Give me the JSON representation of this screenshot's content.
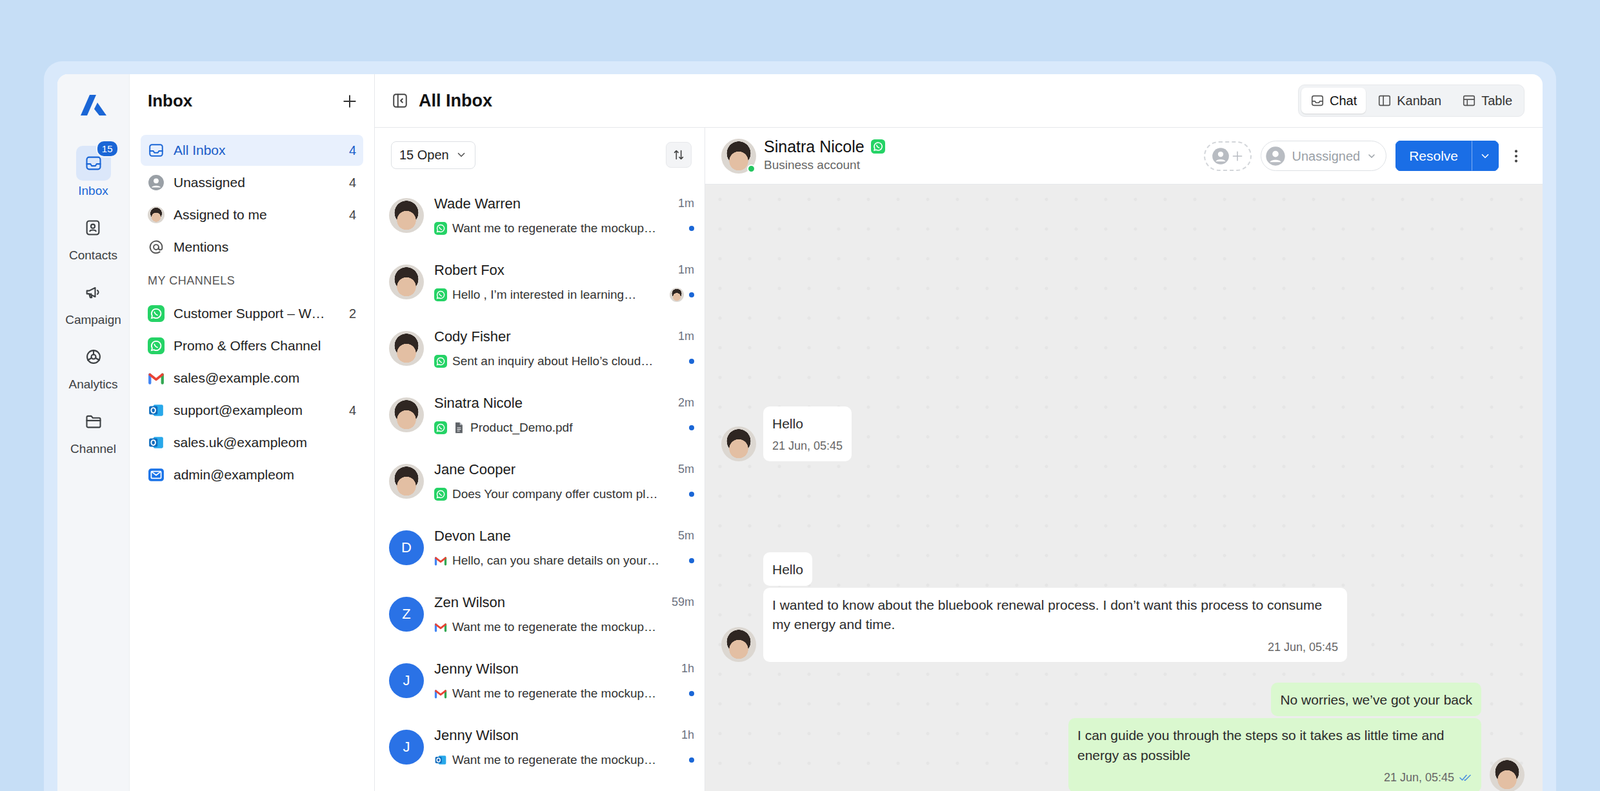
{
  "rail": {
    "items": [
      {
        "label": "Inbox",
        "selected": true,
        "badge": "15"
      },
      {
        "label": "Contacts",
        "selected": false
      },
      {
        "label": "Campaign",
        "selected": false
      },
      {
        "label": "Analytics",
        "selected": false
      },
      {
        "label": "Channel",
        "selected": false
      }
    ]
  },
  "sidebar": {
    "title": "Inbox",
    "items": [
      {
        "label": "All Inbox",
        "count": "4",
        "selected": true
      },
      {
        "label": "Unassigned",
        "count": "4",
        "selected": false
      },
      {
        "label": "Assigned to me",
        "count": "4",
        "selected": false
      },
      {
        "label": "Mentions",
        "selected": false
      }
    ],
    "channels_title": "MY CHANNELS",
    "channels": [
      {
        "label": "Customer Support – W…",
        "count": "2",
        "kind": "whatsapp"
      },
      {
        "label": "Promo & Offers Channel",
        "kind": "whatsapp"
      },
      {
        "label": "sales@example.com",
        "kind": "gmail"
      },
      {
        "label": "support@exampleom",
        "count": "4",
        "kind": "outlook"
      },
      {
        "label": "sales.uk@exampleom",
        "kind": "outlook"
      },
      {
        "label": "admin@exampleom",
        "kind": "mail"
      }
    ]
  },
  "header": {
    "title": "All Inbox",
    "views": [
      {
        "label": "Chat",
        "selected": true
      },
      {
        "label": "Kanban",
        "selected": false
      },
      {
        "label": "Table",
        "selected": false
      }
    ]
  },
  "list": {
    "filter": "15 Open",
    "items": [
      {
        "name": "Wade Warren",
        "time": "1m",
        "preview": "Want me to regenerate the mockup…",
        "channel": "whatsapp",
        "avatar": "photo",
        "attachment": false,
        "assigned": false,
        "unread": true
      },
      {
        "name": "Robert Fox",
        "time": "1m",
        "preview": "Hello , I’m interested in learning…",
        "channel": "whatsapp",
        "avatar": "photo",
        "attachment": false,
        "assigned": true,
        "unread": true
      },
      {
        "name": "Cody Fisher",
        "time": "1m",
        "preview": "Sent an inquiry about Hello’s cloud…",
        "channel": "whatsapp",
        "avatar": "photo",
        "attachment": false,
        "assigned": false,
        "unread": true
      },
      {
        "name": "Sinatra Nicole",
        "time": "2m",
        "preview": "Product_Demo.pdf",
        "channel": "whatsapp",
        "avatar": "photo",
        "attachment": true,
        "assigned": false,
        "unread": true
      },
      {
        "name": "Jane Cooper",
        "time": "5m",
        "preview": "Does Your company offer custom pl…",
        "channel": "whatsapp",
        "avatar": "photo",
        "attachment": false,
        "assigned": false,
        "unread": true
      },
      {
        "name": "Devon Lane",
        "time": "5m",
        "preview": "Hello, can you share details on your…",
        "channel": "gmail",
        "avatar": "letter",
        "initial": "D",
        "attachment": false,
        "assigned": false,
        "unread": true
      },
      {
        "name": "Zen Wilson",
        "time": "59m",
        "preview": "Want me to regenerate the mockup…",
        "channel": "gmail",
        "avatar": "letter",
        "initial": "Z",
        "attachment": false,
        "assigned": false,
        "unread": false
      },
      {
        "name": "Jenny Wilson",
        "time": "1h",
        "preview": "Want me to regenerate the mockup…",
        "channel": "gmail",
        "avatar": "letter",
        "initial": "J",
        "attachment": false,
        "assigned": false,
        "unread": true
      },
      {
        "name": "Jenny Wilson",
        "time": "1h",
        "preview": "Want me to regenerate the mockup…",
        "channel": "outlook",
        "avatar": "letter",
        "initial": "J",
        "attachment": false,
        "assigned": false,
        "unread": true
      }
    ]
  },
  "chat": {
    "contact": {
      "name": "Sinatra Nicole",
      "subtitle": "Business account",
      "online": true,
      "channel": "whatsapp"
    },
    "assignee": "Unassigned",
    "resolve": "Resolve",
    "groups": [
      {
        "kind": "in",
        "bubbles": [
          {
            "text": "Hello",
            "time": "21 Jun, 05:45"
          }
        ]
      },
      {
        "kind": "in",
        "bubbles": [
          {
            "text": "Hello"
          },
          {
            "text": "I wanted to know about the bluebook renewal process. I don’t want this process to consume my energy and time.",
            "time": "21 Jun, 05:45"
          }
        ]
      },
      {
        "kind": "out",
        "bubbles": [
          {
            "text": "No worries, we’ve got your back"
          },
          {
            "text": "I can guide you through the steps so it takes as little time and energy as possible",
            "time": "21 Jun, 05:45",
            "read": true
          }
        ]
      }
    ]
  }
}
